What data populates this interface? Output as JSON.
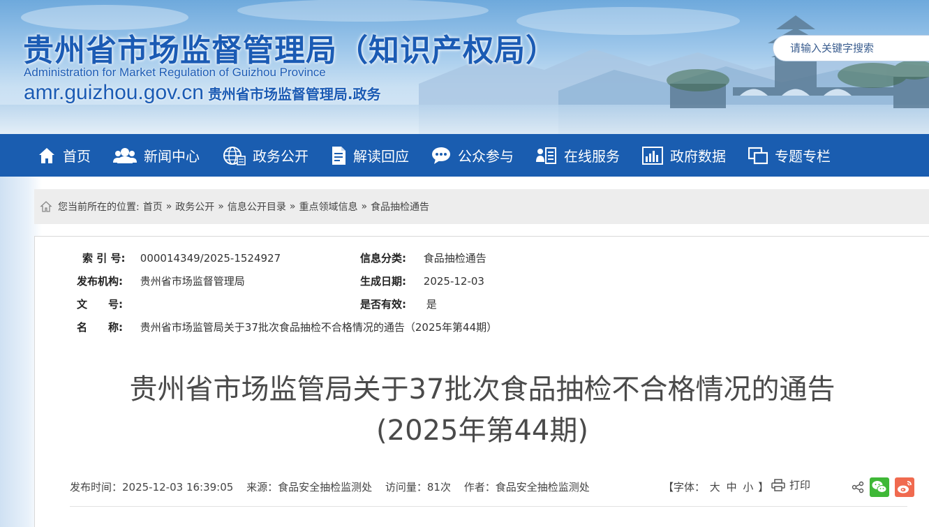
{
  "header": {
    "title": "贵州省市场监督管理局（知识产权局）",
    "title_en": "Administration for Market Regulation of Guizhou Province",
    "domain": "amr.guizhou.gov.cn",
    "domain_cn": "贵州省市场监督管理局.政务",
    "search_placeholder": "请输入关键字搜索"
  },
  "nav": {
    "items": [
      {
        "label": "首页",
        "icon": "home-icon"
      },
      {
        "label": "新闻中心",
        "icon": "people-icon"
      },
      {
        "label": "政务公开",
        "icon": "globe-icon"
      },
      {
        "label": "解读回应",
        "icon": "document-icon"
      },
      {
        "label": "公众参与",
        "icon": "chat-icon"
      },
      {
        "label": "在线服务",
        "icon": "user-list-icon"
      },
      {
        "label": "政府数据",
        "icon": "bar-chart-icon"
      },
      {
        "label": "专题专栏",
        "icon": "windows-icon"
      }
    ]
  },
  "breadcrumb": {
    "prefix": "您当前所在的位置:",
    "items": [
      "首页",
      "政务公开",
      "信息公开目录",
      "重点领域信息",
      "食品抽检通告"
    ],
    "separator": "»"
  },
  "meta": {
    "index_label": "索 引 号:",
    "index_value": "000014349/2025-1524927",
    "category_label": "信息分类:",
    "category_value": "食品抽检通告",
    "publisher_label": "发布机构:",
    "publisher_value": "贵州省市场监督管理局",
    "date_label": "生成日期:",
    "date_value": "2025-12-03",
    "docno_label": "文　　号:",
    "docno_value": "",
    "valid_label": "是否有效:",
    "valid_value": "是",
    "name_label": "名　　称:",
    "name_value": "贵州省市场监管局关于37批次食品抽检不合格情况的通告（2025年第44期）"
  },
  "article": {
    "title_line1": "贵州省市场监管局关于37批次食品抽检不合格情况的通告",
    "title_line2": "(2025年第44期)",
    "publish_time": "发布时间：2025-12-03 16:39:05",
    "source": "来源：食品安全抽检监测处",
    "views": "访问量：81次",
    "author": "作者：食品安全抽检监测处",
    "font_label": "【字体：",
    "font_large": "大",
    "font_medium": "中",
    "font_small": "小",
    "font_close": "】",
    "print_label": "打印"
  },
  "colors": {
    "nav_bg": "#1a5db0",
    "title_blue": "#1b5bb4",
    "wechat": "#3fb837",
    "weibo": "#f06a4f"
  }
}
